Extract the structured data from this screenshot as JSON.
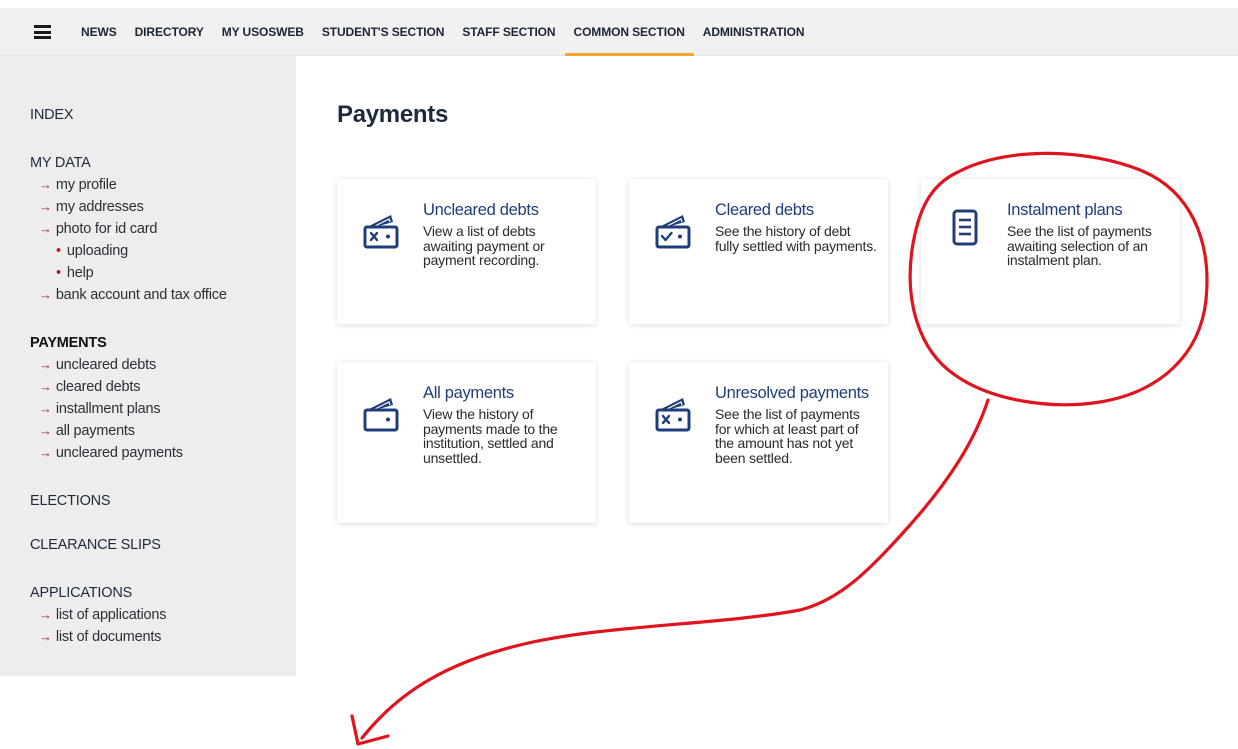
{
  "nav": {
    "items": [
      {
        "label": "NEWS"
      },
      {
        "label": "DIRECTORY"
      },
      {
        "label": "MY USOSWEB"
      },
      {
        "label": "STUDENT'S SECTION"
      },
      {
        "label": "STAFF SECTION"
      },
      {
        "label": "COMMON SECTION",
        "active": true
      },
      {
        "label": "ADMINISTRATION"
      }
    ]
  },
  "sidebar": {
    "index": "INDEX",
    "my_data": {
      "heading": "MY DATA",
      "links": [
        "my profile",
        "my addresses",
        "photo for id card"
      ],
      "sublinks": [
        "uploading",
        "help"
      ],
      "last_link": "bank account and tax office"
    },
    "payments": {
      "heading": "PAYMENTS",
      "links": [
        "uncleared debts",
        "cleared debts",
        "installment plans",
        "all payments",
        "uncleared payments"
      ]
    },
    "elections": "ELECTIONS",
    "clearance": "CLEARANCE SLIPS",
    "applications": {
      "heading": "APPLICATIONS",
      "links": [
        "list of applications",
        "list of documents"
      ]
    }
  },
  "main": {
    "title": "Payments",
    "cards": [
      {
        "title": "Uncleared debts",
        "desc": "View a list of debts awaiting payment or payment recording.",
        "icon": "wallet-x-icon"
      },
      {
        "title": "Cleared debts",
        "desc": "See the history of debt fully settled with payments.",
        "icon": "wallet-check-icon"
      },
      {
        "title": "Instalment plans",
        "desc": "See the list of payments awaiting selection of an instalment plan.",
        "icon": "document-list-icon"
      },
      {
        "title": "All payments",
        "desc": "View the history of payments made to the institution, settled and unsettled.",
        "icon": "wallet-icon"
      },
      {
        "title": "Unresolved payments",
        "desc": "See the list of payments for which at least part of the amount has not yet been settled.",
        "icon": "wallet-x-icon"
      }
    ]
  },
  "colors": {
    "accent": "#f0a72e",
    "link_blue": "#1f3d78",
    "arrow_red": "#b41f2a",
    "annotation_red": "#e0141e"
  }
}
